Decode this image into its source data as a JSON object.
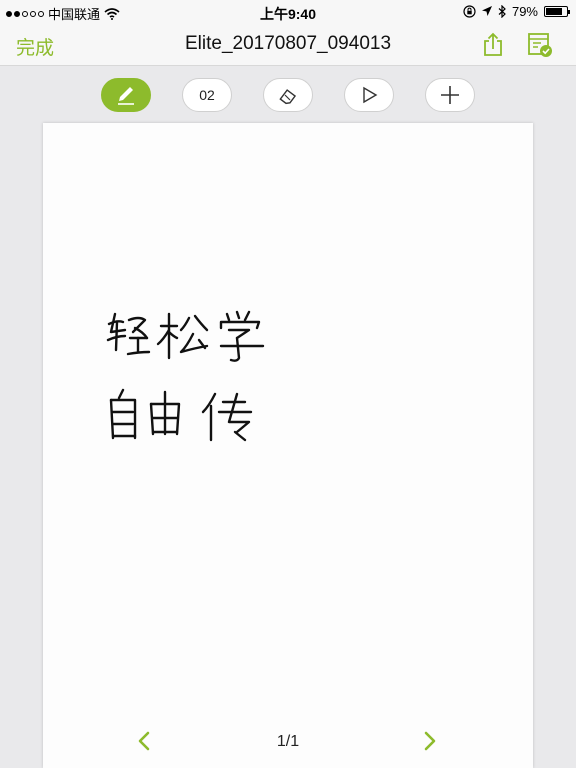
{
  "status_bar": {
    "carrier": "中国联通",
    "time": "上午9:40",
    "battery_percent": "79%",
    "battery_level": 0.79,
    "signal_bars_filled": 2,
    "signal_bars_total": 5,
    "icons": [
      "wifi-icon",
      "orientation-lock-icon",
      "location-icon",
      "bluetooth-icon",
      "battery-icon"
    ]
  },
  "nav": {
    "done_label": "完成",
    "title": "Elite_20170807_094013",
    "icons": [
      "share-icon",
      "save-document-icon"
    ],
    "accent_color": "#8dbb2c"
  },
  "toolbar": {
    "tools": [
      {
        "name": "pen",
        "icon": "pen-icon",
        "active": true
      },
      {
        "name": "size",
        "label": "02",
        "active": false
      },
      {
        "name": "eraser",
        "icon": "eraser-icon",
        "active": false
      },
      {
        "name": "play",
        "icon": "play-icon",
        "active": false
      },
      {
        "name": "add",
        "icon": "plus-icon",
        "active": false
      }
    ]
  },
  "note": {
    "handwritten_lines": [
      "轻松学",
      "自由传"
    ]
  },
  "pager": {
    "label": "1/1",
    "prev_icon": "chevron-left-icon",
    "next_icon": "chevron-right-icon"
  }
}
